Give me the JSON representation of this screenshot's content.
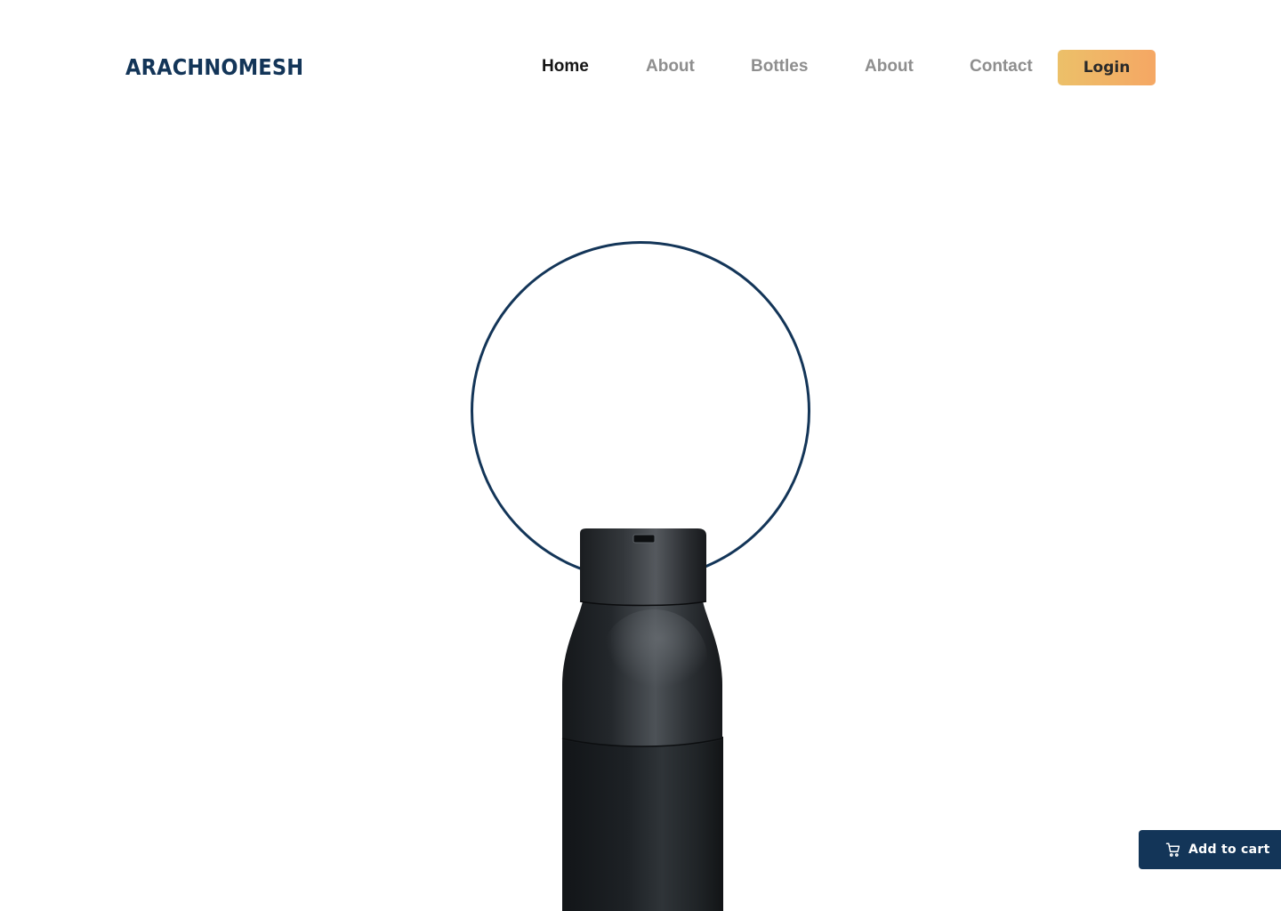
{
  "header": {
    "brand": "ARACHNOMESH",
    "nav": [
      {
        "label": "Home",
        "active": true
      },
      {
        "label": "About",
        "active": false
      },
      {
        "label": "Bottles",
        "active": false
      },
      {
        "label": "About",
        "active": false
      },
      {
        "label": "Contact",
        "active": false
      }
    ],
    "login_label": "Login"
  },
  "hero": {
    "ring_color": "#133558",
    "product_image": "black-water-bottle"
  },
  "cart": {
    "label": "Add to cart",
    "icon": "shopping-cart-icon"
  },
  "colors": {
    "brand": "#133558",
    "nav_active": "#141414",
    "nav_inactive": "#8e8e8e",
    "login_gradient_start": "#ecc069",
    "login_gradient_end": "#f5a764"
  }
}
